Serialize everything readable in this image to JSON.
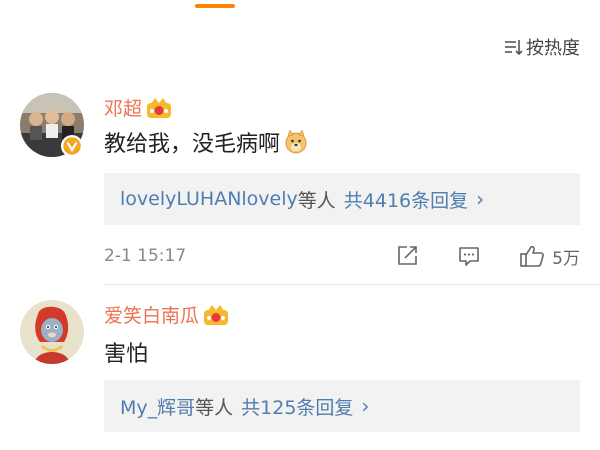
{
  "header": {
    "sort_label": "按热度",
    "sort_icon": "sort-icon"
  },
  "comments": [
    {
      "username": "邓超",
      "badge_icon": "crown-icon",
      "verified_icon": "verified-v-icon",
      "text": "教给我，没毛病啊",
      "emoji_icon": "doge-icon",
      "replies": {
        "names": "lovelyLUHANlovely",
        "connector": "等人",
        "count_label": "共4416条回复",
        "chevron": "›"
      },
      "time": "2-1 15:17",
      "actions": {
        "share_icon": "share-icon",
        "comment_icon": "comment-icon",
        "like_icon": "thumbs-up-icon",
        "like_count": "5万"
      }
    },
    {
      "username": "爱笑白南瓜",
      "badge_icon": "crown-icon",
      "text": "害怕",
      "replies": {
        "names": "My_辉哥",
        "connector": "等人",
        "count_label": "共125条回复",
        "chevron": "›"
      }
    }
  ],
  "colors": {
    "accent": "#ff8200",
    "username": "#eb7350",
    "link": "#507daf",
    "reply_bg": "#f2f2f2"
  }
}
